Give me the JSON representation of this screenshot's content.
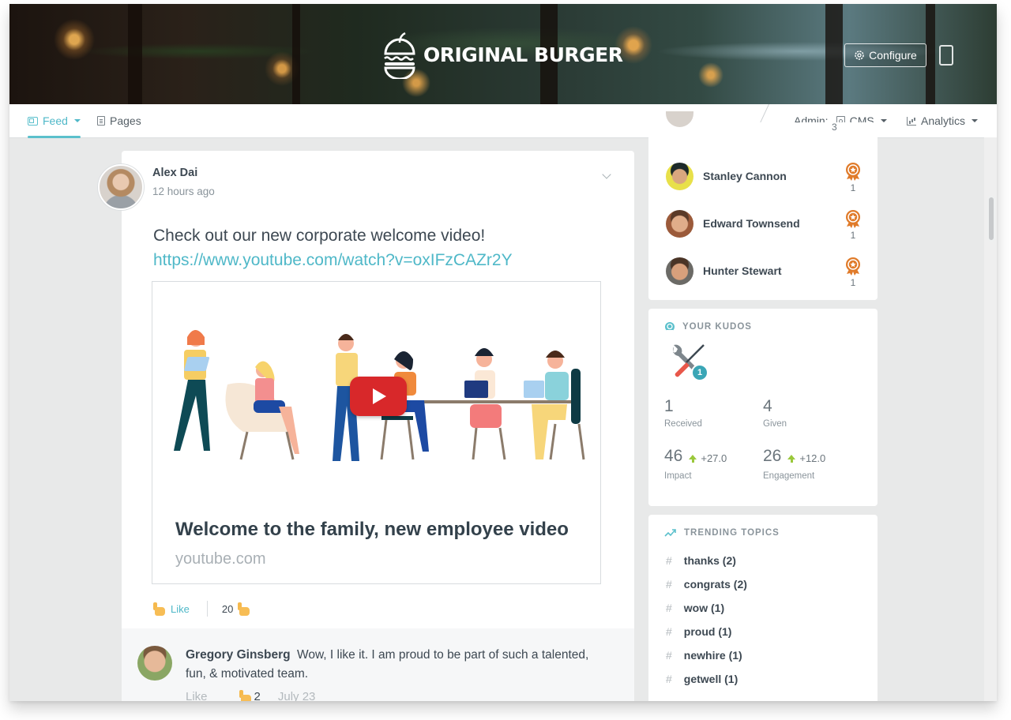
{
  "brand": {
    "name": "ORIGINAL BURGER"
  },
  "header": {
    "configure_label": "Configure"
  },
  "nav": {
    "feed_label": "Feed",
    "pages_label": "Pages",
    "admin_label": "Admin:",
    "cms_label": "CMS",
    "analytics_label": "Analytics"
  },
  "post": {
    "author": "Alex Dai",
    "time": "12 hours ago",
    "text": "Check out our new corporate welcome video!",
    "link": "https://www.youtube.com/watch?v=oxIFzCAZr2Y",
    "preview": {
      "title": "Welcome to the family, new employee video",
      "domain": "youtube.com"
    },
    "like_label": "Like",
    "like_count": "20",
    "comment": {
      "author": "Gregory Ginsberg",
      "text": "Wow, I like it. I am proud to be part of such a talented, fun, & motivated team.",
      "like_label": "Like",
      "like_count": "2",
      "date": "July 23"
    }
  },
  "leaderboard": {
    "partial_count": "3",
    "items": [
      {
        "name": "Stanley Cannon",
        "count": "1"
      },
      {
        "name": "Edward Townsend",
        "count": "1"
      },
      {
        "name": "Hunter Stewart",
        "count": "1"
      }
    ]
  },
  "kudos": {
    "title": "YOUR KUDOS",
    "badge_count": "1",
    "received": {
      "value": "1",
      "label": "Received"
    },
    "given": {
      "value": "4",
      "label": "Given"
    },
    "impact": {
      "value": "46",
      "delta": "+27.0",
      "label": "Impact"
    },
    "engagement": {
      "value": "26",
      "delta": "+12.0",
      "label": "Engagement"
    }
  },
  "trending": {
    "title": "TRENDING TOPICS",
    "topics": [
      {
        "label": "thanks (2)"
      },
      {
        "label": "congrats (2)"
      },
      {
        "label": "wow (1)"
      },
      {
        "label": "proud (1)"
      },
      {
        "label": "newhire (1)"
      },
      {
        "label": "getwell (1)"
      }
    ]
  },
  "colors": {
    "accent": "#4fb8c8",
    "medal": "#e07b2a",
    "play": "#d8282a",
    "up": "#9ac83b"
  }
}
